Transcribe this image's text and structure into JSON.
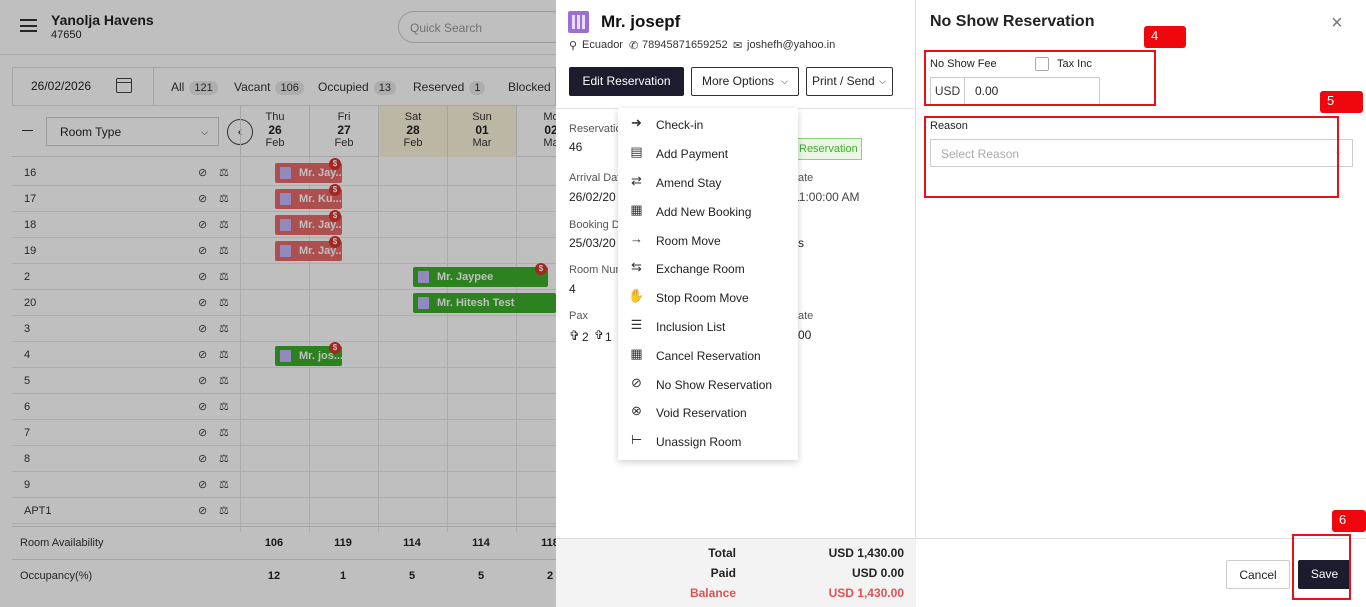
{
  "app": {
    "hotel_name": "Yanolja Havens",
    "hotel_code": "47650",
    "search_placeholder": "Quick Search"
  },
  "filters": {
    "date": "26/02/2026",
    "tabs": [
      {
        "label": "All",
        "count": "121"
      },
      {
        "label": "Vacant",
        "count": "106"
      },
      {
        "label": "Occupied",
        "count": "13"
      },
      {
        "label": "Reserved",
        "count": "1"
      },
      {
        "label": "Blocked",
        "count": ""
      }
    ]
  },
  "grid": {
    "room_type_label": "Room Type",
    "days": [
      {
        "dow": "Thu",
        "day": "26",
        "mon": "Feb"
      },
      {
        "dow": "Fri",
        "day": "27",
        "mon": "Feb"
      },
      {
        "dow": "Sat",
        "day": "28",
        "mon": "Feb"
      },
      {
        "dow": "Sun",
        "day": "01",
        "mon": "Mar"
      },
      {
        "dow": "Mo",
        "day": "02",
        "mon": "Ma"
      }
    ],
    "rooms": [
      "16",
      "17",
      "18",
      "19",
      "2",
      "20",
      "3",
      "4",
      "5",
      "6",
      "7",
      "8",
      "9",
      "APT1"
    ],
    "bookings": [
      {
        "name": "Mr. Jay..."
      },
      {
        "name": "Mr. Ku..."
      },
      {
        "name": "Mr. Jay..."
      },
      {
        "name": "Mr. Jay..."
      },
      {
        "name": "Mr. Jaypee"
      },
      {
        "name": "Mr. Hitesh Test"
      },
      {
        "name": "Mr. jos..."
      }
    ],
    "availability_label": "Room Availability",
    "availability": [
      "106",
      "119",
      "114",
      "114",
      "118"
    ],
    "occupancy_label": "Occupancy(%)",
    "occupancy": [
      "12",
      "1",
      "5",
      "5",
      "2"
    ]
  },
  "reservation": {
    "guest_name": "Mr. josepf",
    "country": "Ecuador",
    "phone": "78945871659252",
    "email": "joshefh@yahoo.in",
    "edit_button": "Edit Reservation",
    "more_options": "More Options",
    "print_send": "Print / Send",
    "fields": [
      {
        "label": "Reservation",
        "value": "46"
      },
      {
        "label": "Arrival Dat",
        "value": "26/02/20"
      },
      {
        "label": "Booking D",
        "value": "25/03/20"
      },
      {
        "label": "Room Num",
        "value": "4"
      },
      {
        "label": "Pax",
        "value": ""
      }
    ],
    "pax_adults": "2",
    "pax_children": "1",
    "status_tag": "Reservation",
    "right_fragments": {
      "ate1": "ate",
      "time": "11:00:00 AM",
      "s": "s",
      "ate2": "ate",
      "zero": "00"
    },
    "totals": [
      {
        "label": "Total",
        "value": "USD 1,430.00",
        "color": "#222222"
      },
      {
        "label": "Paid",
        "value": "USD 0.00",
        "color": "#222222"
      },
      {
        "label": "Balance",
        "value": "USD 1,430.00",
        "color": "#e05252"
      }
    ]
  },
  "menu": {
    "items": [
      {
        "label": "Check-in",
        "icon": "check-in-icon"
      },
      {
        "label": "Add Payment",
        "icon": "payment-card-icon"
      },
      {
        "label": "Amend Stay",
        "icon": "amend-calendar-icon"
      },
      {
        "label": "Add New Booking",
        "icon": "calendar-icon"
      },
      {
        "label": "Room Move",
        "icon": "bed-move-icon"
      },
      {
        "label": "Exchange Room",
        "icon": "exchange-bed-icon"
      },
      {
        "label": "Stop Room Move",
        "icon": "hand-stop-icon"
      },
      {
        "label": "Inclusion List",
        "icon": "food-tray-icon"
      },
      {
        "label": "Cancel Reservation",
        "icon": "cancel-calendar-icon"
      },
      {
        "label": "No Show Reservation",
        "icon": "eye-slash-icon"
      },
      {
        "label": "Void Reservation",
        "icon": "circle-x-icon"
      },
      {
        "label": "Unassign Room",
        "icon": "bed-remove-icon"
      }
    ]
  },
  "no_show": {
    "title": "No Show Reservation",
    "fee_label": "No Show Fee",
    "tax_inc_label": "Tax Inc",
    "currency": "USD",
    "amount": "0.00",
    "reason_label": "Reason",
    "reason_placeholder": "Select Reason",
    "cancel": "Cancel",
    "save": "Save"
  },
  "annotations": {
    "tag4": "4",
    "tag5": "5",
    "tag6": "6",
    "color": "#e8111b"
  }
}
